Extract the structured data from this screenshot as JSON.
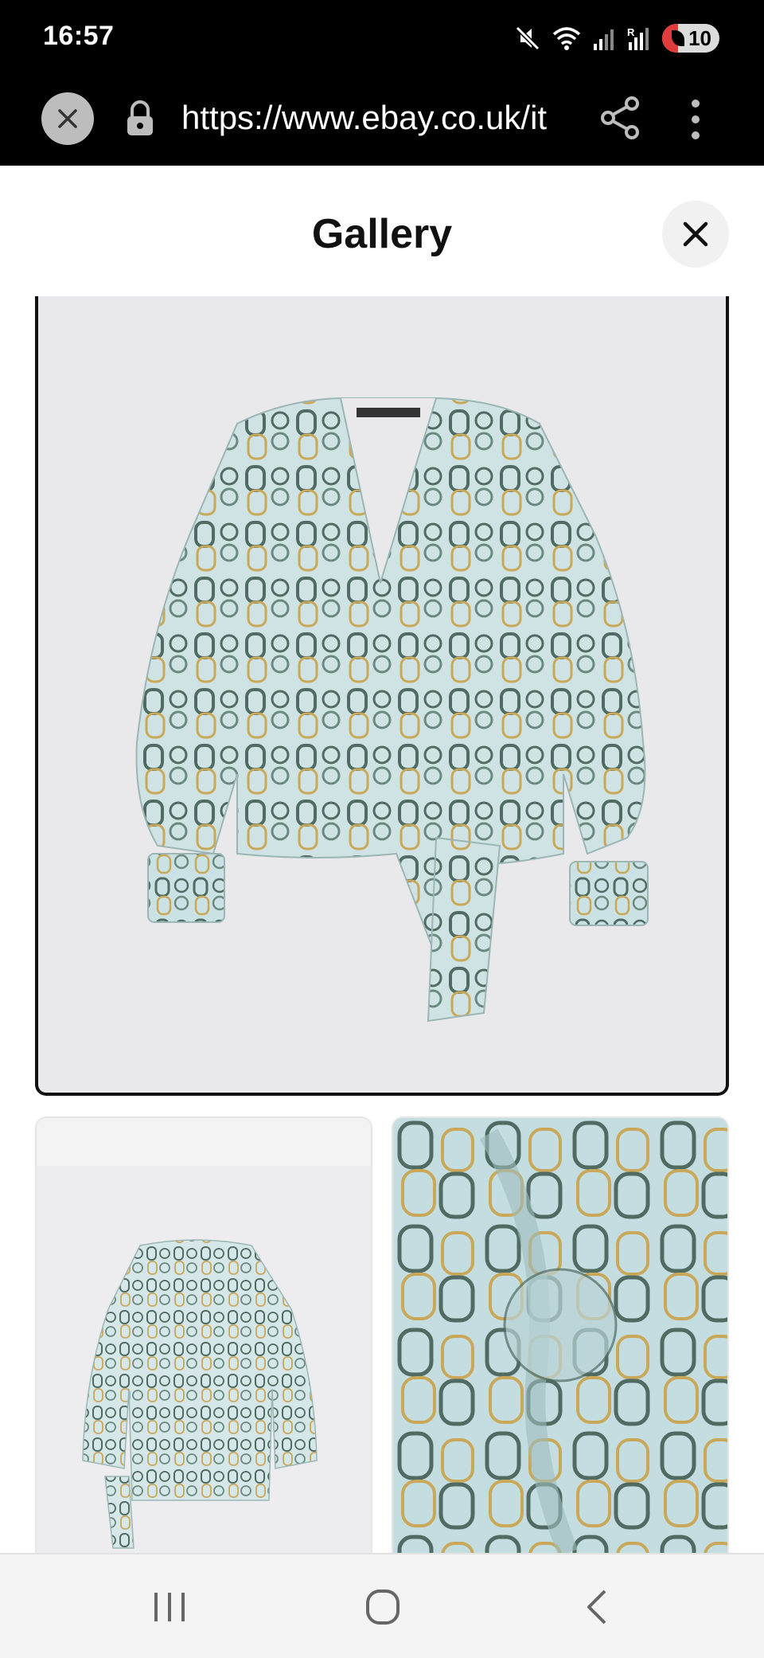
{
  "status_bar": {
    "time": "16:57",
    "battery": "10",
    "icons": [
      "mute-icon",
      "wifi-icon",
      "signal-icon",
      "signal-roaming-icon",
      "battery-icon"
    ]
  },
  "browser": {
    "url": "https://www.ebay.co.uk/it",
    "icons": [
      "close-tab-icon",
      "lock-icon",
      "share-icon",
      "more-icon"
    ]
  },
  "gallery": {
    "title": "Gallery",
    "close_icon": "close-icon",
    "images": [
      {
        "name": "main-image",
        "description_icon": "blouse-front-image"
      },
      {
        "name": "thumbnail-1",
        "description_icon": "blouse-back-image"
      },
      {
        "name": "thumbnail-2",
        "description_icon": "blouse-detail-image"
      }
    ]
  },
  "colors": {
    "status_bar_bg": "#000000",
    "fabric_base": "#c7dfe2",
    "chain_dark": "#4f6b62",
    "chain_gold": "#c9a85a"
  },
  "nav": {
    "icons": [
      "recents-icon",
      "home-icon",
      "back-icon"
    ]
  }
}
